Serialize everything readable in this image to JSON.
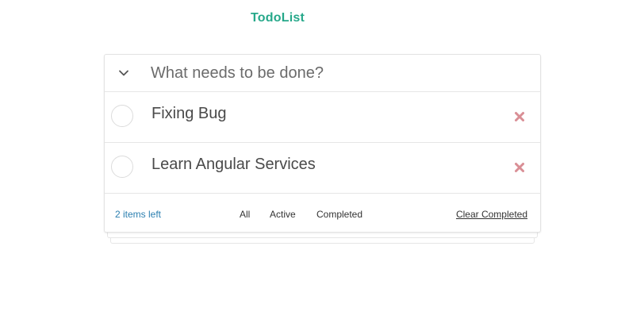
{
  "app": {
    "title": "TodoList"
  },
  "new_todo": {
    "placeholder": "What needs to be done?",
    "value": "",
    "toggle_icon": "chevron-down-icon"
  },
  "todos": [
    {
      "label": "Fixing Bug",
      "completed": false,
      "destroy_icon": "close-icon"
    },
    {
      "label": "Learn Angular Services",
      "completed": false,
      "destroy_icon": "close-icon"
    }
  ],
  "footer": {
    "items_left": "2 items left",
    "filters": {
      "all": "All",
      "active": "Active",
      "completed": "Completed"
    },
    "clear_completed": "Clear Completed"
  },
  "colors": {
    "title": "#26a88a",
    "items_left": "#2b7fb0",
    "destroy": "#d98e95",
    "chevron": "#555555"
  }
}
